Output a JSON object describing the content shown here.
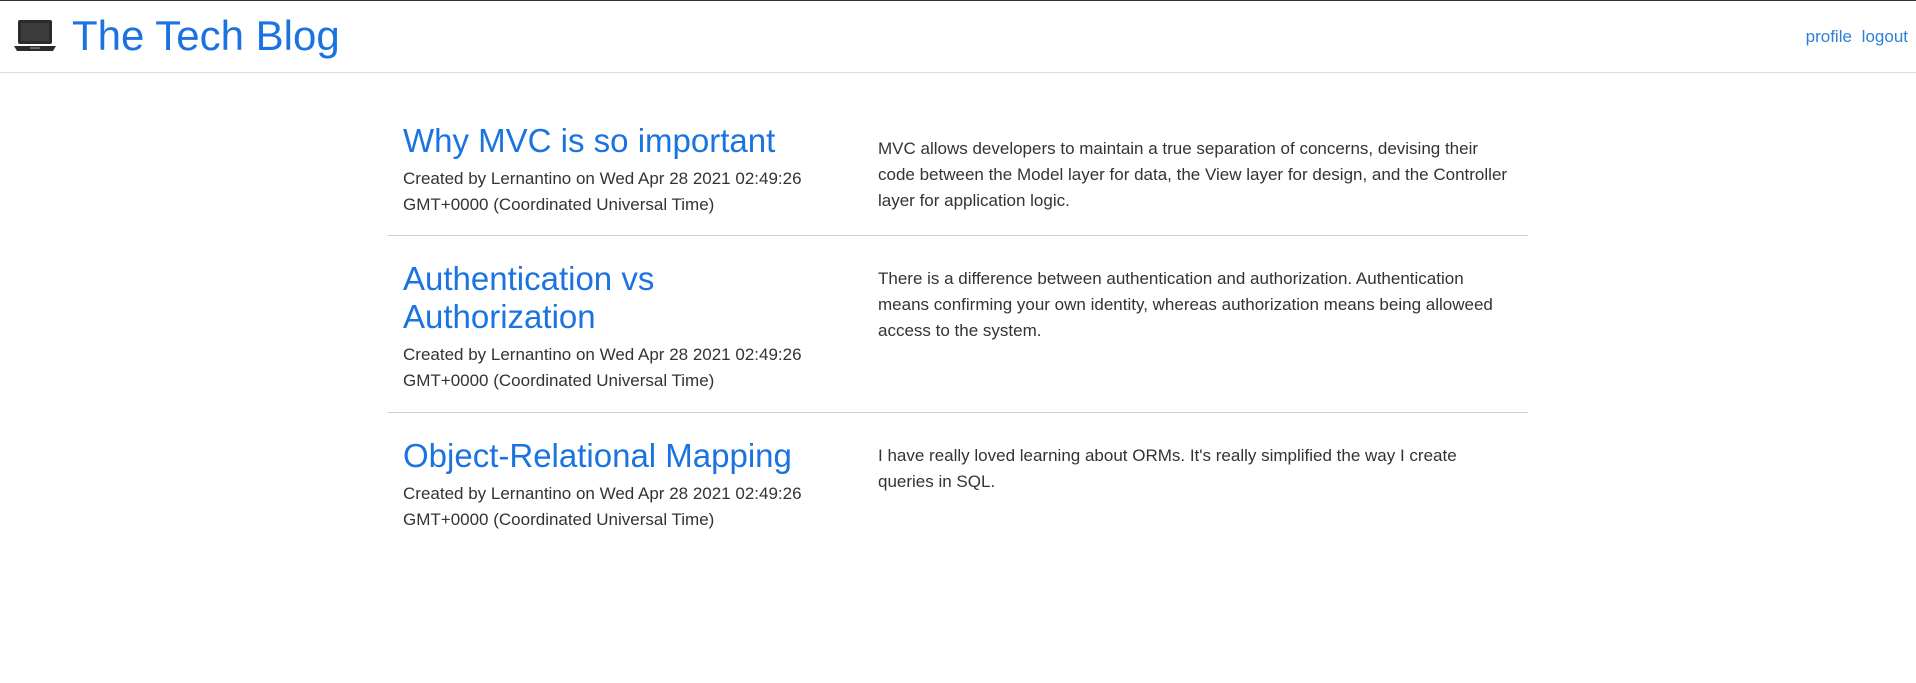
{
  "header": {
    "brand_icon": "laptop-icon",
    "title": "The Tech Blog",
    "nav": {
      "profile_label": "profile",
      "logout_label": "logout"
    }
  },
  "posts": [
    {
      "title": "Why MVC is so important",
      "meta": "Created by Lernantino on Wed Apr 28 2021 02:49:26 GMT+0000 (Coordinated Universal Time)",
      "body": "MVC allows developers to maintain a true separation of concerns, devising their code between the Model layer for data, the View layer for design, and the Controller layer for application logic."
    },
    {
      "title": "Authentication vs Authorization",
      "meta": "Created by Lernantino on Wed Apr 28 2021 02:49:26 GMT+0000 (Coordinated Universal Time)",
      "body": "There is a difference between authentication and authorization. Authentication means confirming your own identity, whereas authorization means being alloweed access to the system."
    },
    {
      "title": "Object-Relational Mapping",
      "meta": "Created by Lernantino on Wed Apr 28 2021 02:49:26 GMT+0000 (Coordinated Universal Time)",
      "body": "I have really loved learning about ORMs. It's really simplified the way I create queries in SQL."
    }
  ],
  "colors": {
    "brand": "#1a73e0",
    "link": "#2d7ed8",
    "text": "#333333",
    "divider": "#cfcfcf"
  }
}
